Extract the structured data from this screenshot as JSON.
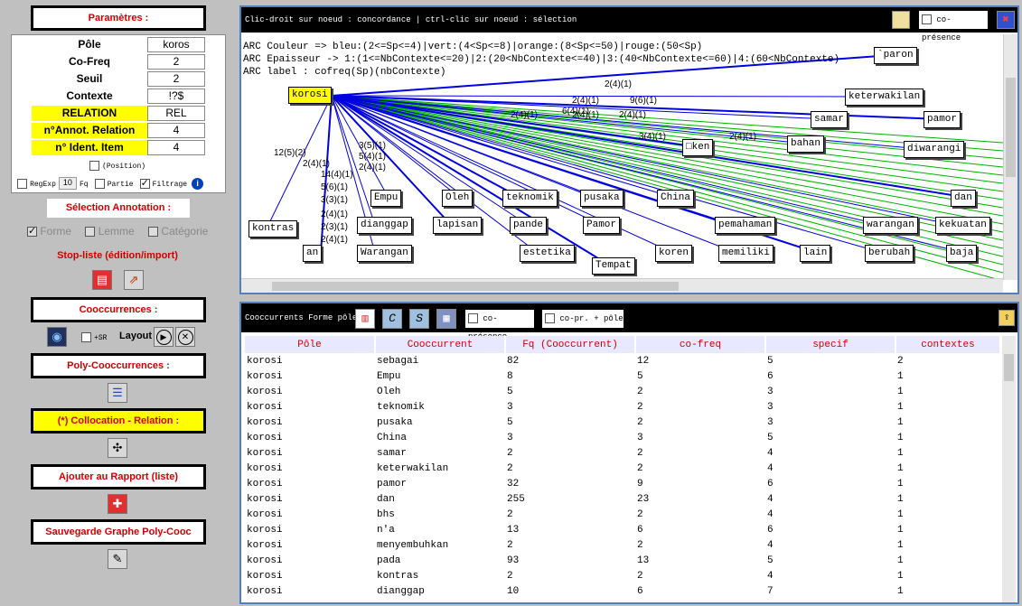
{
  "left": {
    "params_title": "Paramètres :",
    "params": [
      {
        "label": "Pôle",
        "value": "koros"
      },
      {
        "label": "Co-Freq",
        "value": "2"
      },
      {
        "label": "Seuil",
        "value": "2"
      },
      {
        "label": "Contexte",
        "value": "!?$"
      },
      {
        "label": "RELATION",
        "value": "REL"
      },
      {
        "label": "n°Annot. Relation",
        "value": "4"
      },
      {
        "label": "n° Ident. Item",
        "value": "4"
      }
    ],
    "position_label": "(Position)",
    "regexp_label": "RegExp",
    "fq_value": "10",
    "fq_label": "Fq",
    "partie_label": "Partie",
    "filtrage_label": "Filtrage",
    "info_icon": "i",
    "selection_title": "Sélection Annotation :",
    "forme_label": "Forme",
    "lemme_label": "Lemme",
    "categorie_label": "Catégorie",
    "stoplist_label": "Stop-liste (édition/import)",
    "cooc_title": "Cooccurrences :",
    "sr_label": "+SR",
    "layout_label": "Layout",
    "polycooc_title": "Poly-Cooccurrences :",
    "collocation_title": "(*) Collocation - Relation :",
    "rapport_title": "Ajouter au Rapport (liste)",
    "sauvegarde_title": "Sauvegarde Graphe Poly-Cooc"
  },
  "graph": {
    "title": "Clic-droit sur noeud : concordance | ctrl-clic sur noeud : sélection",
    "copresence_label": "co-présence",
    "legend": [
      "ARC Couleur => bleu:(2<=Sp<=4)|vert:(4<Sp<=8)|orange:(8<Sp<=50)|rouge:(50<Sp)",
      "ARC Epaisseur -> 1:(1<=NbContexte<=20)|2:(20<NbContexte<=40)|3:(40<NbContexte<=60)|4:(60<NbContexte)",
      "ARC label : cofreq(Sp)(nbContexte)"
    ],
    "pole_node": "korosi",
    "nodes": [
      "`paron",
      "keterwakilan",
      "samar",
      "pamor",
      "bahan",
      "diwarangi",
      "□ken",
      "Empu",
      "Oleh",
      "teknomik",
      "pusaka",
      "China",
      "dan",
      "kontras",
      "dianggap",
      "lapisan",
      "pande",
      "Pamor",
      "pemahaman",
      "warangan",
      "kekuatan",
      "an",
      "Warangan",
      "estetika",
      "Tempat",
      "koren",
      "memiliki",
      "lain",
      "berubah",
      "baja"
    ],
    "edge_labels": [
      "2(4)(1)",
      "2(4)(1)",
      "9(6)(1)",
      "2(4)(1)",
      "6(4)(1)",
      "2(4)(1)",
      "2(4)(1)",
      "12(5)(2)",
      "2(4)(1)",
      "14(4)(1)",
      "5(6)(1)",
      "3(3)(1)",
      "2(4)(1)",
      "2(3)(1)",
      "2(4)(1)",
      "3(5)(1)",
      "5(4)(1)",
      "2(4)(1)",
      "3(4)(1)",
      "2(4)(1)"
    ]
  },
  "table": {
    "title": "Cooccurrents Forme pôle",
    "copresence_label": "co-présence",
    "copr_pole_label": "co-pr. + pôle",
    "columns": [
      "Pôle",
      "Cooccurrent",
      "Fq (Cooccurrent)",
      "co-freq",
      "specif",
      "contextes"
    ],
    "rows": [
      [
        "korosi",
        "sebagai",
        "82",
        "12",
        "5",
        "2"
      ],
      [
        "korosi",
        "Empu",
        "8",
        "5",
        "6",
        "1"
      ],
      [
        "korosi",
        "Oleh",
        "5",
        "2",
        "3",
        "1"
      ],
      [
        "korosi",
        "teknomik",
        "3",
        "2",
        "3",
        "1"
      ],
      [
        "korosi",
        "pusaka",
        "5",
        "2",
        "3",
        "1"
      ],
      [
        "korosi",
        "China",
        "3",
        "3",
        "5",
        "1"
      ],
      [
        "korosi",
        "samar",
        "2",
        "2",
        "4",
        "1"
      ],
      [
        "korosi",
        "keterwakilan",
        "2",
        "2",
        "4",
        "1"
      ],
      [
        "korosi",
        "pamor",
        "32",
        "9",
        "6",
        "1"
      ],
      [
        "korosi",
        "dan",
        "255",
        "23",
        "4",
        "1"
      ],
      [
        "korosi",
        "bhs",
        "2",
        "2",
        "4",
        "1"
      ],
      [
        "korosi",
        "n'a",
        "13",
        "6",
        "6",
        "1"
      ],
      [
        "korosi",
        "menyembuhkan",
        "2",
        "2",
        "4",
        "1"
      ],
      [
        "korosi",
        "pada",
        "93",
        "13",
        "5",
        "1"
      ],
      [
        "korosi",
        "kontras",
        "2",
        "2",
        "4",
        "1"
      ],
      [
        "korosi",
        "dianggap",
        "10",
        "6",
        "7",
        "1"
      ]
    ]
  }
}
